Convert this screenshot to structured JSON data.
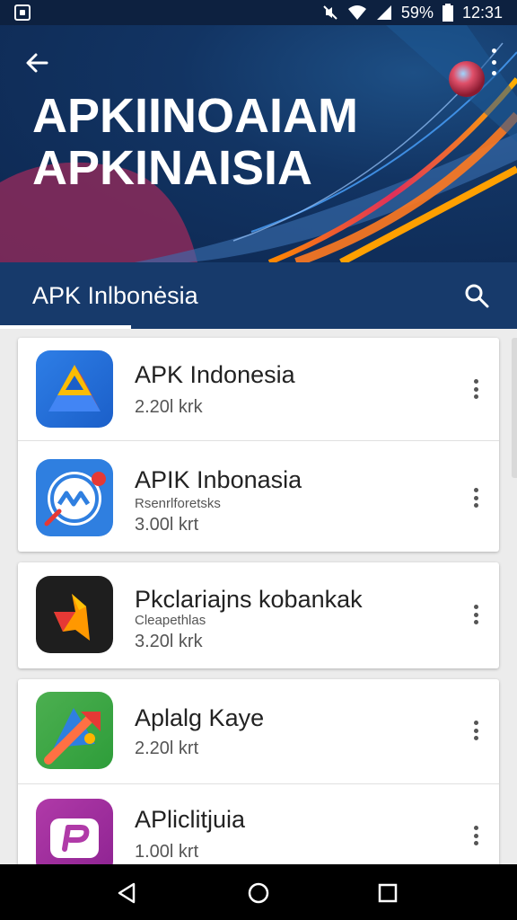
{
  "status_bar": {
    "battery": "59%",
    "time": "12:31",
    "icons": [
      "screenshot-icon",
      "mute-icon",
      "wifi-icon",
      "signal-icon",
      "battery-icon"
    ]
  },
  "hero": {
    "title_line1": "APKIINOAIAM",
    "title_line2": "APKINAISIA"
  },
  "app_bar": {
    "title": "APK Inlbonėsia"
  },
  "apps": [
    {
      "name": "APK Indonesia",
      "subtitle": "",
      "size": "2.20l krk",
      "icon": "drive-triangle-icon"
    },
    {
      "name": "APIK Inbonasia",
      "subtitle": "Rsenrlforetsks",
      "size": "3.00l krt",
      "icon": "blue-circle-logo-icon"
    },
    {
      "name": "Pkclariajns kobankak",
      "subtitle": "Cleapethlas",
      "size": "3.20l krk",
      "icon": "orange-shape-icon"
    },
    {
      "name": "Aplalg Kaye",
      "subtitle": "",
      "size": "2.20l krt",
      "icon": "green-arrow-icon"
    },
    {
      "name": "APliclitjuia",
      "subtitle": "",
      "size": "1.00l krt",
      "icon": "purple-p-icon"
    }
  ],
  "colors": {
    "hero_bg": "#123463",
    "app_bar": "#173a6b",
    "status_bar": "#0d2140"
  }
}
